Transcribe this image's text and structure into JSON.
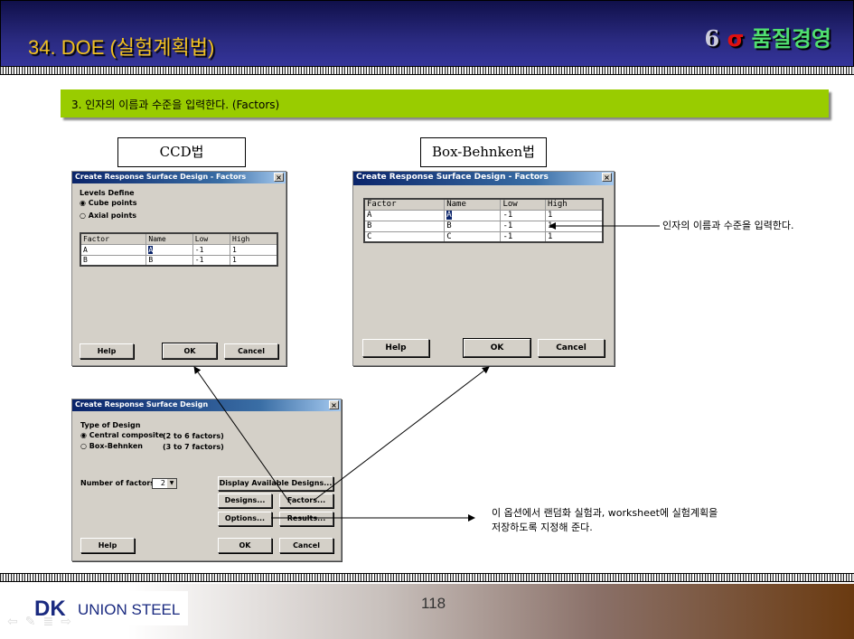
{
  "header": {
    "title": "34. DOE (실험계획법)",
    "brand_num": "6",
    "brand_sigma": "σ",
    "brand_text": "품질경영"
  },
  "banner": "3. 인자의 이름과 수준을 입력한다. (Factors)",
  "labels": {
    "ccd": "CCD법",
    "bb": "Box-Behnken법"
  },
  "ccd_dialog": {
    "title": "Create Response Surface Design - Factors",
    "levels_label": "Levels Define",
    "opt1": "Cube points",
    "opt2": "Axial points",
    "headers": [
      "Factor",
      "Name",
      "Low",
      "High"
    ],
    "rows": [
      [
        "A",
        "A",
        "-1",
        "1"
      ],
      [
        "B",
        "B",
        "-1",
        "1"
      ]
    ],
    "help": "Help",
    "ok": "OK",
    "cancel": "Cancel"
  },
  "bb_dialog": {
    "title": "Create Response Surface Design - Factors",
    "headers": [
      "Factor",
      "Name",
      "Low",
      "High"
    ],
    "rows": [
      [
        "A",
        "A",
        "-1",
        "1"
      ],
      [
        "B",
        "B",
        "-1",
        "1"
      ],
      [
        "C",
        "C",
        "-1",
        "1"
      ]
    ],
    "help": "Help",
    "ok": "OK",
    "cancel": "Cancel"
  },
  "main_dialog": {
    "title": "Create Response Surface Design",
    "type_label": "Type of Design",
    "opt1": "Central composite",
    "opt1_range": "(2 to 6 factors)",
    "opt2": "Box-Behnken",
    "opt2_range": "(3 to 7 factors)",
    "num_label": "Number of factors:",
    "num_value": "2",
    "display": "Display Available Designs...",
    "designs": "Designs...",
    "factors": "Factors...",
    "options": "Options...",
    "results": "Results...",
    "help": "Help",
    "ok": "OK",
    "cancel": "Cancel"
  },
  "notes": {
    "factor_note": "인자의 이름과 수준을 입력한다.",
    "options_note_1": "이 옵션에서 랜덤화 실험과, worksheet에 실험계획을",
    "options_note_2": "저장하도록 지정해 준다."
  },
  "footer": {
    "page": "118",
    "logo_mark": "DK",
    "logo_text": "UNION STEEL"
  }
}
